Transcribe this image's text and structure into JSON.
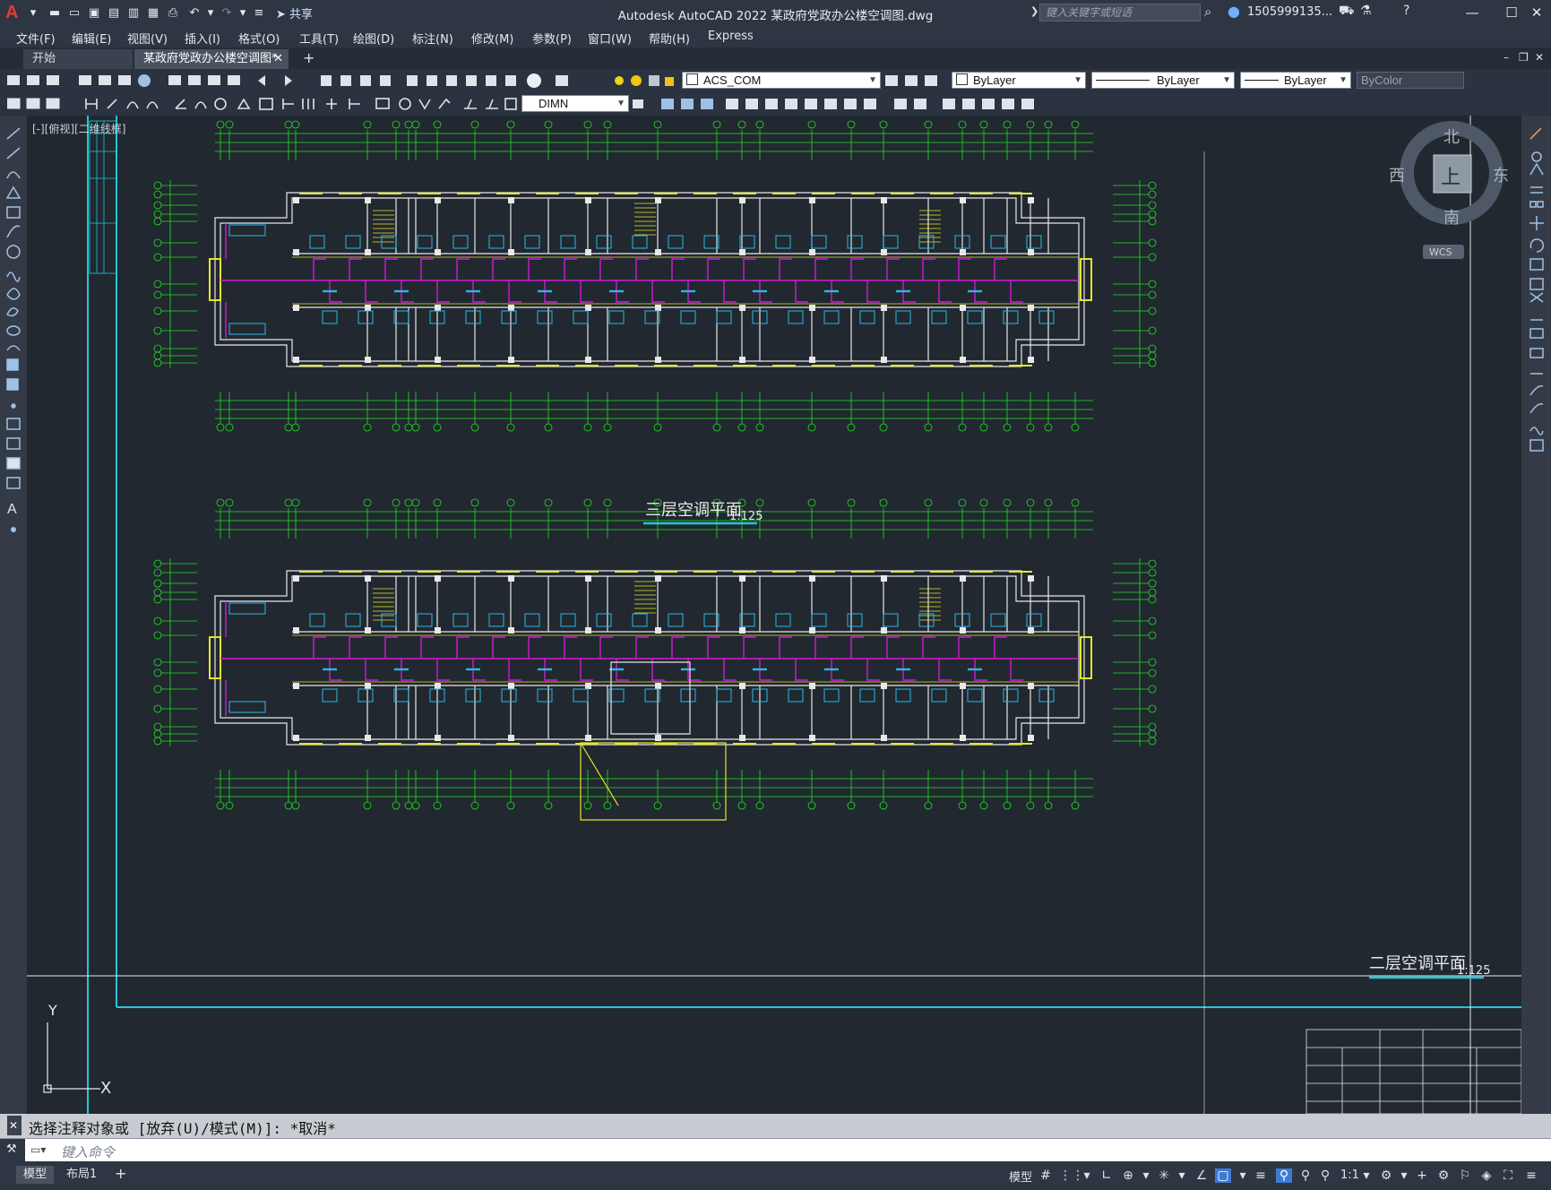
{
  "app": {
    "logo": "A",
    "title": "Autodesk AutoCAD 2022    某政府党政办公楼空调图.dwg",
    "share_label": "共享",
    "search_placeholder": "键入关键字或短语",
    "user": "1505999135...",
    "window_controls": [
      "minimize-icon",
      "maximize-icon",
      "close-icon"
    ]
  },
  "menu": [
    "文件(F)",
    "编辑(E)",
    "视图(V)",
    "插入(I)",
    "格式(O)",
    "工具(T)",
    "绘图(D)",
    "标注(N)",
    "修改(M)",
    "参数(P)",
    "窗口(W)",
    "帮助(H)",
    "Express"
  ],
  "tabs": [
    {
      "label": "开始",
      "active": false
    },
    {
      "label": "某政府党政办公楼空调图*",
      "active": true
    }
  ],
  "toolbar": {
    "layer": "ACS_COM",
    "color": "ByLayer",
    "linetype": "ByLayer",
    "lineweight": "ByLayer",
    "plotstyle": "ByColor",
    "dimstyle": "DIMN"
  },
  "viewport": {
    "label": "[-][俯视][二维线框]"
  },
  "viewcube": {
    "north": "北",
    "south": "南",
    "east": "东",
    "west": "西",
    "face": "上",
    "wcs": "WCS"
  },
  "drawing": {
    "plan3_title": "三层空调平面",
    "plan3_scale": "1:125",
    "plan2_title": "二层空调平面",
    "plan2_scale": "1:125",
    "colors": {
      "wall": "#e8e8e8",
      "grid": "#22e022",
      "duct": "#d21bd2",
      "unit": "#2bb7e6",
      "window": "#e6e629",
      "frame": "#21c8d8"
    }
  },
  "command": {
    "history": "选择注释对象或 [放弃(U)/模式(M)]: *取消*",
    "placeholder": "键入命令"
  },
  "status": {
    "layouts": [
      "模型",
      "布局1"
    ],
    "model_label": "模型",
    "scale": "1:1"
  }
}
